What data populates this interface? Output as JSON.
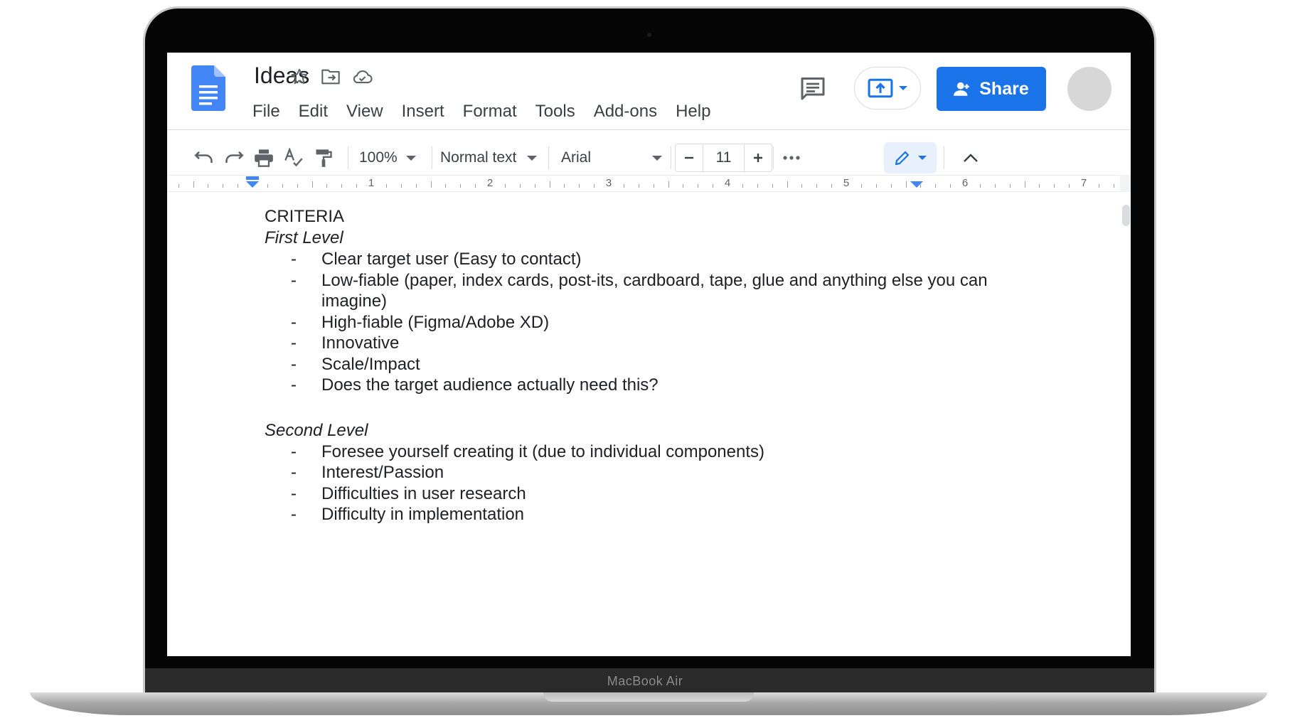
{
  "device": {
    "brand_label": "MacBook Air"
  },
  "document": {
    "title": "Ideas"
  },
  "menu": [
    "File",
    "Edit",
    "View",
    "Insert",
    "Format",
    "Tools",
    "Add-ons",
    "Help"
  ],
  "header": {
    "share_label": "Share"
  },
  "toolbar": {
    "zoom": "100%",
    "style": "Normal text",
    "font": "Arial",
    "font_size": "11"
  },
  "ruler": {
    "numbers": [
      "1",
      "2",
      "3",
      "4",
      "5",
      "6",
      "7"
    ]
  },
  "content": {
    "heading": "CRITERIA",
    "first_level_title": "First Level",
    "first_level_items": [
      "Clear target user (Easy to contact)",
      "Low-fiable (paper, index cards, post-its, cardboard, tape, glue and anything else you can imagine)",
      "High-fiable (Figma/Adobe XD)",
      "Innovative",
      "Scale/Impact",
      "Does the target audience actually need this?"
    ],
    "second_level_title": "Second Level",
    "second_level_items": [
      "Foresee yourself creating it (due to individual components)",
      "Interest/Passion",
      "Difficulties in user research",
      "Difficulty in implementation"
    ]
  },
  "colors": {
    "accent": "#1a73e8",
    "text": "#202124",
    "toolbar_icon": "#5f6368"
  },
  "icons": [
    "docs-logo-icon",
    "star-icon",
    "move-to-folder-icon",
    "cloud-status-icon",
    "comments-icon",
    "present-icon",
    "share-person-icon",
    "undo-icon",
    "redo-icon",
    "print-icon",
    "spellcheck-icon",
    "paint-format-icon",
    "more-options-icon",
    "edit-pencil-icon",
    "collapse-chevron-icon"
  ]
}
